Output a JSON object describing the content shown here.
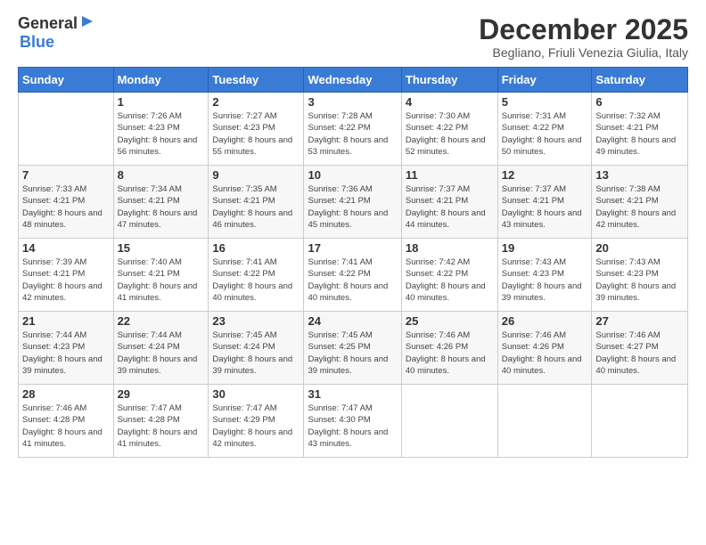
{
  "logo": {
    "line1": "General",
    "line2": "Blue"
  },
  "title": "December 2025",
  "subtitle": "Begliano, Friuli Venezia Giulia, Italy",
  "weekdays": [
    "Sunday",
    "Monday",
    "Tuesday",
    "Wednesday",
    "Thursday",
    "Friday",
    "Saturday"
  ],
  "weeks": [
    [
      {
        "day": "",
        "sunrise": "",
        "sunset": "",
        "daylight": ""
      },
      {
        "day": "1",
        "sunrise": "Sunrise: 7:26 AM",
        "sunset": "Sunset: 4:23 PM",
        "daylight": "Daylight: 8 hours and 56 minutes."
      },
      {
        "day": "2",
        "sunrise": "Sunrise: 7:27 AM",
        "sunset": "Sunset: 4:23 PM",
        "daylight": "Daylight: 8 hours and 55 minutes."
      },
      {
        "day": "3",
        "sunrise": "Sunrise: 7:28 AM",
        "sunset": "Sunset: 4:22 PM",
        "daylight": "Daylight: 8 hours and 53 minutes."
      },
      {
        "day": "4",
        "sunrise": "Sunrise: 7:30 AM",
        "sunset": "Sunset: 4:22 PM",
        "daylight": "Daylight: 8 hours and 52 minutes."
      },
      {
        "day": "5",
        "sunrise": "Sunrise: 7:31 AM",
        "sunset": "Sunset: 4:22 PM",
        "daylight": "Daylight: 8 hours and 50 minutes."
      },
      {
        "day": "6",
        "sunrise": "Sunrise: 7:32 AM",
        "sunset": "Sunset: 4:21 PM",
        "daylight": "Daylight: 8 hours and 49 minutes."
      }
    ],
    [
      {
        "day": "7",
        "sunrise": "Sunrise: 7:33 AM",
        "sunset": "Sunset: 4:21 PM",
        "daylight": "Daylight: 8 hours and 48 minutes."
      },
      {
        "day": "8",
        "sunrise": "Sunrise: 7:34 AM",
        "sunset": "Sunset: 4:21 PM",
        "daylight": "Daylight: 8 hours and 47 minutes."
      },
      {
        "day": "9",
        "sunrise": "Sunrise: 7:35 AM",
        "sunset": "Sunset: 4:21 PM",
        "daylight": "Daylight: 8 hours and 46 minutes."
      },
      {
        "day": "10",
        "sunrise": "Sunrise: 7:36 AM",
        "sunset": "Sunset: 4:21 PM",
        "daylight": "Daylight: 8 hours and 45 minutes."
      },
      {
        "day": "11",
        "sunrise": "Sunrise: 7:37 AM",
        "sunset": "Sunset: 4:21 PM",
        "daylight": "Daylight: 8 hours and 44 minutes."
      },
      {
        "day": "12",
        "sunrise": "Sunrise: 7:37 AM",
        "sunset": "Sunset: 4:21 PM",
        "daylight": "Daylight: 8 hours and 43 minutes."
      },
      {
        "day": "13",
        "sunrise": "Sunrise: 7:38 AM",
        "sunset": "Sunset: 4:21 PM",
        "daylight": "Daylight: 8 hours and 42 minutes."
      }
    ],
    [
      {
        "day": "14",
        "sunrise": "Sunrise: 7:39 AM",
        "sunset": "Sunset: 4:21 PM",
        "daylight": "Daylight: 8 hours and 42 minutes."
      },
      {
        "day": "15",
        "sunrise": "Sunrise: 7:40 AM",
        "sunset": "Sunset: 4:21 PM",
        "daylight": "Daylight: 8 hours and 41 minutes."
      },
      {
        "day": "16",
        "sunrise": "Sunrise: 7:41 AM",
        "sunset": "Sunset: 4:22 PM",
        "daylight": "Daylight: 8 hours and 40 minutes."
      },
      {
        "day": "17",
        "sunrise": "Sunrise: 7:41 AM",
        "sunset": "Sunset: 4:22 PM",
        "daylight": "Daylight: 8 hours and 40 minutes."
      },
      {
        "day": "18",
        "sunrise": "Sunrise: 7:42 AM",
        "sunset": "Sunset: 4:22 PM",
        "daylight": "Daylight: 8 hours and 40 minutes."
      },
      {
        "day": "19",
        "sunrise": "Sunrise: 7:43 AM",
        "sunset": "Sunset: 4:23 PM",
        "daylight": "Daylight: 8 hours and 39 minutes."
      },
      {
        "day": "20",
        "sunrise": "Sunrise: 7:43 AM",
        "sunset": "Sunset: 4:23 PM",
        "daylight": "Daylight: 8 hours and 39 minutes."
      }
    ],
    [
      {
        "day": "21",
        "sunrise": "Sunrise: 7:44 AM",
        "sunset": "Sunset: 4:23 PM",
        "daylight": "Daylight: 8 hours and 39 minutes."
      },
      {
        "day": "22",
        "sunrise": "Sunrise: 7:44 AM",
        "sunset": "Sunset: 4:24 PM",
        "daylight": "Daylight: 8 hours and 39 minutes."
      },
      {
        "day": "23",
        "sunrise": "Sunrise: 7:45 AM",
        "sunset": "Sunset: 4:24 PM",
        "daylight": "Daylight: 8 hours and 39 minutes."
      },
      {
        "day": "24",
        "sunrise": "Sunrise: 7:45 AM",
        "sunset": "Sunset: 4:25 PM",
        "daylight": "Daylight: 8 hours and 39 minutes."
      },
      {
        "day": "25",
        "sunrise": "Sunrise: 7:46 AM",
        "sunset": "Sunset: 4:26 PM",
        "daylight": "Daylight: 8 hours and 40 minutes."
      },
      {
        "day": "26",
        "sunrise": "Sunrise: 7:46 AM",
        "sunset": "Sunset: 4:26 PM",
        "daylight": "Daylight: 8 hours and 40 minutes."
      },
      {
        "day": "27",
        "sunrise": "Sunrise: 7:46 AM",
        "sunset": "Sunset: 4:27 PM",
        "daylight": "Daylight: 8 hours and 40 minutes."
      }
    ],
    [
      {
        "day": "28",
        "sunrise": "Sunrise: 7:46 AM",
        "sunset": "Sunset: 4:28 PM",
        "daylight": "Daylight: 8 hours and 41 minutes."
      },
      {
        "day": "29",
        "sunrise": "Sunrise: 7:47 AM",
        "sunset": "Sunset: 4:28 PM",
        "daylight": "Daylight: 8 hours and 41 minutes."
      },
      {
        "day": "30",
        "sunrise": "Sunrise: 7:47 AM",
        "sunset": "Sunset: 4:29 PM",
        "daylight": "Daylight: 8 hours and 42 minutes."
      },
      {
        "day": "31",
        "sunrise": "Sunrise: 7:47 AM",
        "sunset": "Sunset: 4:30 PM",
        "daylight": "Daylight: 8 hours and 43 minutes."
      },
      {
        "day": "",
        "sunrise": "",
        "sunset": "",
        "daylight": ""
      },
      {
        "day": "",
        "sunrise": "",
        "sunset": "",
        "daylight": ""
      },
      {
        "day": "",
        "sunrise": "",
        "sunset": "",
        "daylight": ""
      }
    ]
  ]
}
